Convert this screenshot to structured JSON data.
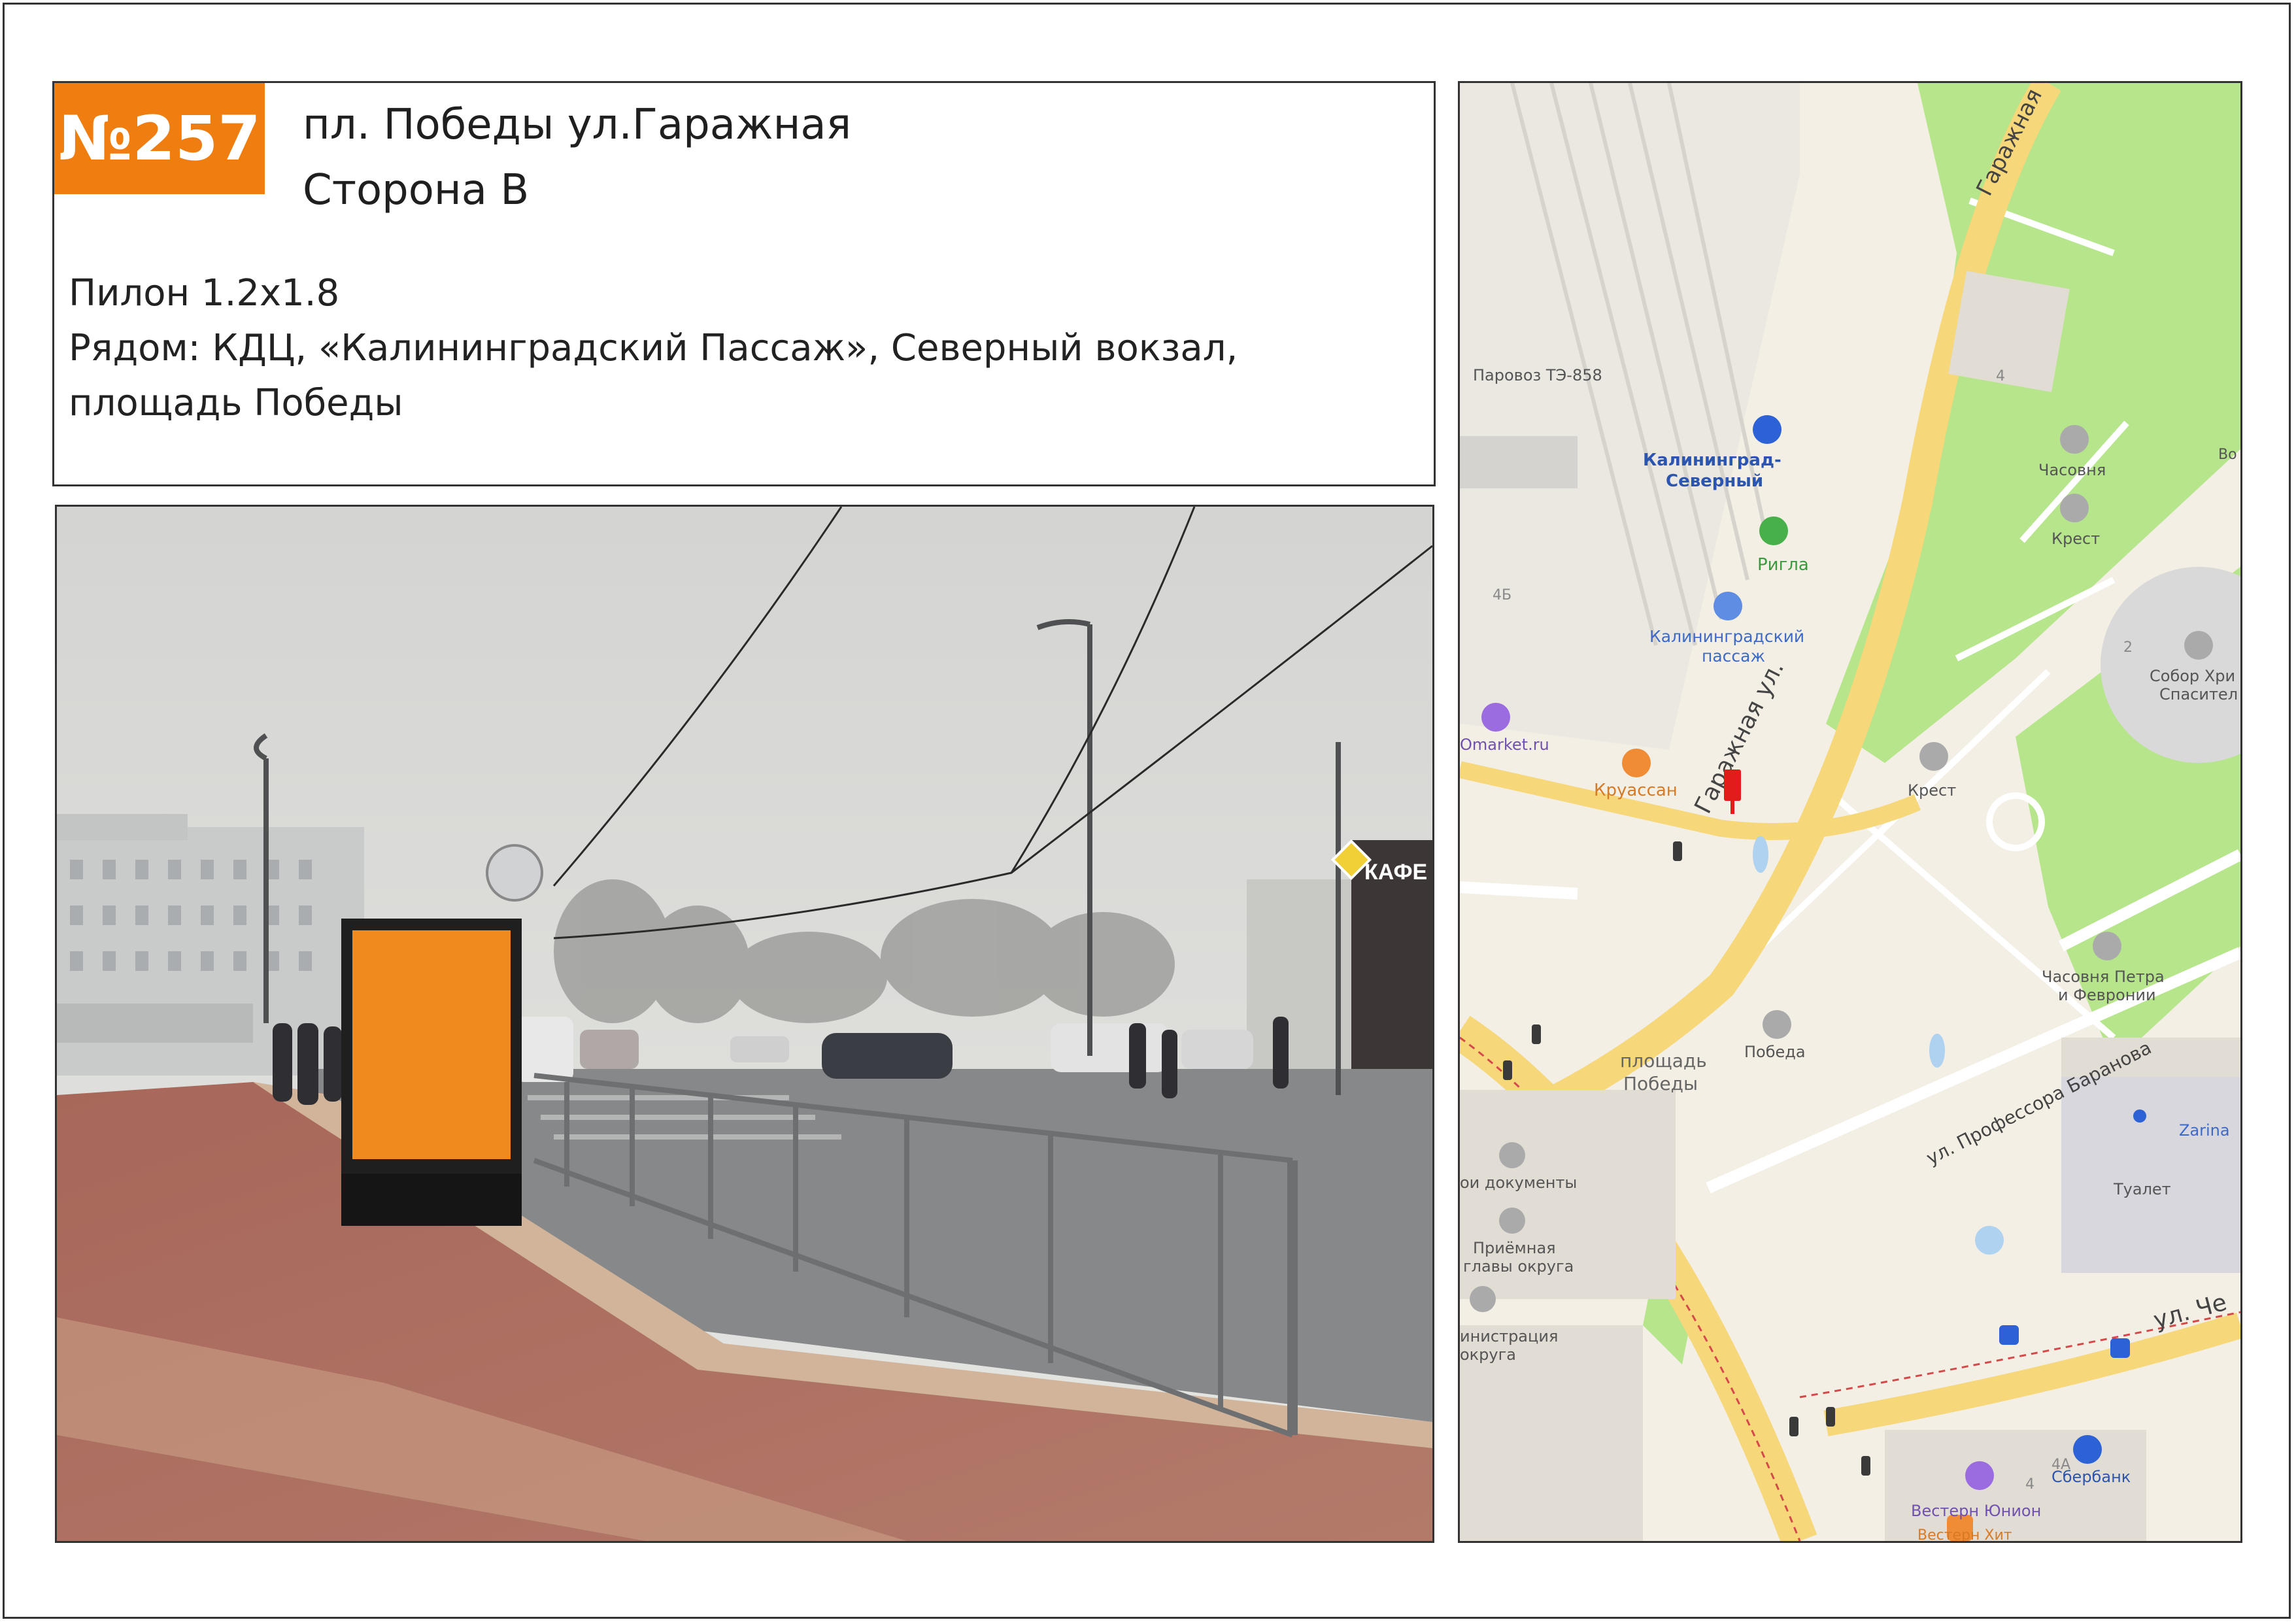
{
  "card": {
    "number": "№257",
    "title_line1": "пл. Победы ул.Гаражная",
    "title_line2": "Сторона В",
    "format": "Пилон 1.2x1.8",
    "nearby_line1": "Рядом: КДЦ, «Калининградский Пассаж», Северный вокзал,",
    "nearby_line2": "площадь Победы"
  },
  "photo": {
    "sign_text": "КАФЕ",
    "billboard_color": "#f08a1e"
  },
  "map": {
    "labels": {
      "lok": "Паровоз ТЭ-858",
      "station1": "Калининград-",
      "station2": "Северный",
      "rigla": "Ригла",
      "passage1": "Калининградский",
      "passage2": "пассаж",
      "omarket": "Omarket.ru",
      "kruassan": "Круассан",
      "street_garazh": "Гаражная ул.",
      "street_garazh_top": "Гаражная",
      "chasovnya": "Часовня",
      "krest1": "Крест",
      "krest2": "Крест",
      "sobor1": "Собор Хри",
      "sobor2": "Спасител",
      "chasovnya_pf1": "Часовня Петра",
      "chasovnya_pf2": "и Февронии",
      "pobeda": "Победа",
      "ploshad1": "площадь",
      "ploshad2": "Победы",
      "baranova": "ул. Профессора Баранова",
      "zarina": "Zarina",
      "tualet": "Туалет",
      "docs": "ои документы",
      "priem1": "Приёмная",
      "priem2": "главы округа",
      "admin1": "инистрация",
      "admin2": "округа",
      "street_che": "ул. Че",
      "western": "Вестерн Юнион",
      "sberbank": "Сбербанк",
      "vesternhit": "Вестерн Хит",
      "b4": "4",
      "b4b": "4Б",
      "b2": "2",
      "b4a": "4А",
      "b4c": "4",
      "vo": "Во"
    },
    "colors": {
      "park": "#b6e58c",
      "road": "#f6d77a",
      "pin": "#e21b1b"
    }
  }
}
